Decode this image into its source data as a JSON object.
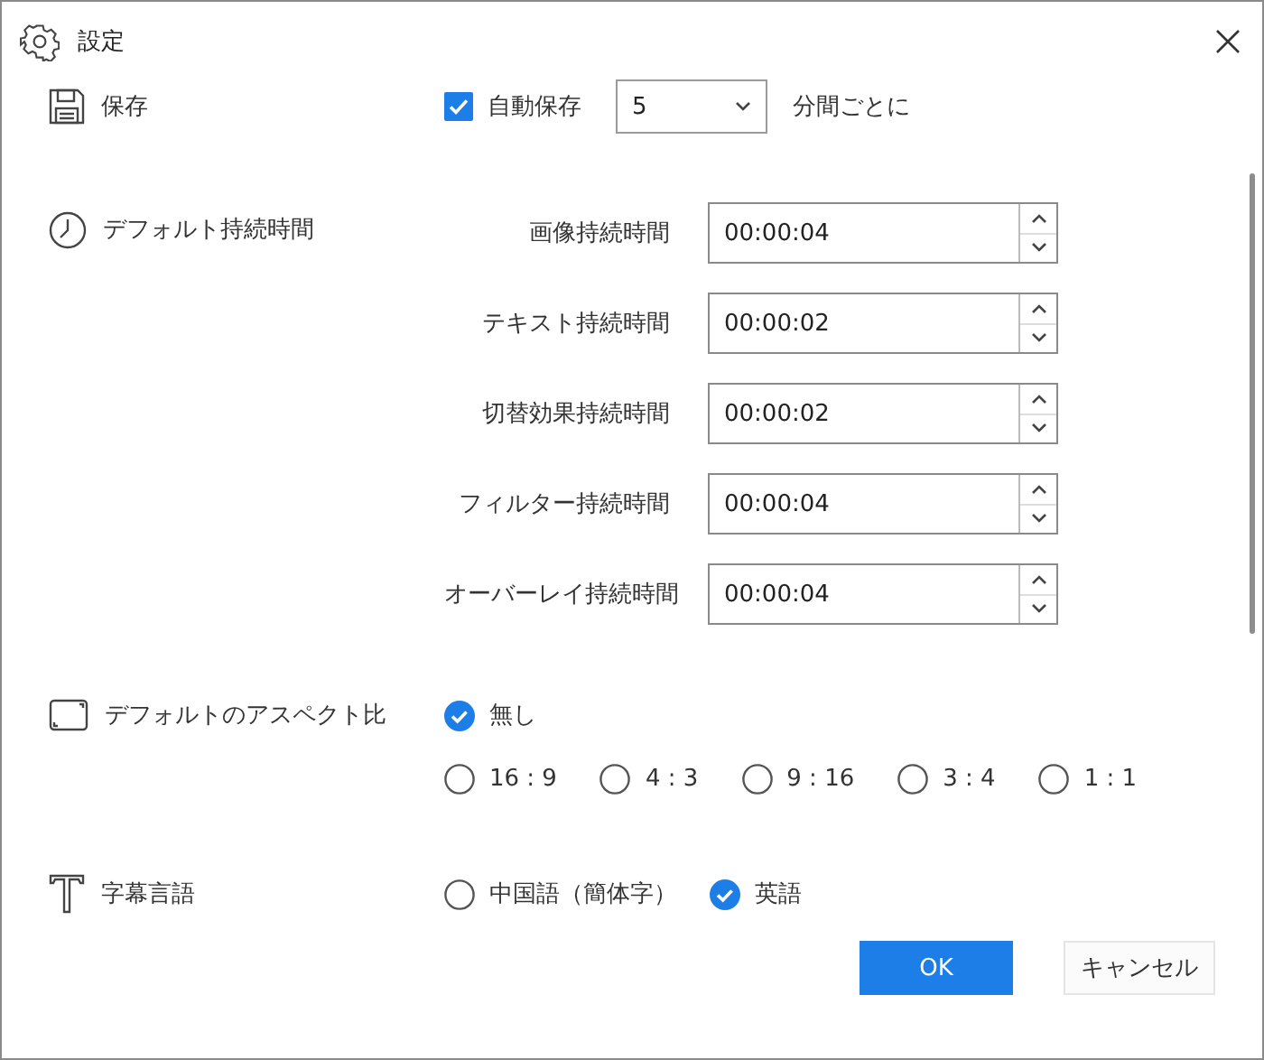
{
  "window": {
    "title": "設定"
  },
  "save": {
    "label": "保存",
    "autosave": {
      "label": "自動保存",
      "checked": true
    },
    "interval": {
      "value": "5"
    },
    "unit": "分間ごとに"
  },
  "duration": {
    "label": "デフォルト持続時間",
    "fields": [
      {
        "label": "画像持続時間",
        "value": "00:00:04"
      },
      {
        "label": "テキスト持続時間",
        "value": "00:00:02"
      },
      {
        "label": "切替効果持続時間",
        "value": "00:00:02"
      },
      {
        "label": "フィルター持続時間",
        "value": "00:00:04"
      },
      {
        "label": "オーバーレイ持続時間",
        "value": "00:00:04"
      }
    ]
  },
  "aspect": {
    "label": "デフォルトのアスペクト比",
    "options": [
      {
        "label": "無し",
        "selected": true
      },
      {
        "label": "16 : 9",
        "selected": false
      },
      {
        "label": "4 : 3",
        "selected": false
      },
      {
        "label": "9 : 16",
        "selected": false
      },
      {
        "label": "3 : 4",
        "selected": false
      },
      {
        "label": "1 : 1",
        "selected": false
      }
    ]
  },
  "subtitle": {
    "label": "字幕言語",
    "options": [
      {
        "label": "中国語（簡体字）",
        "selected": false
      },
      {
        "label": "英語",
        "selected": true
      }
    ]
  },
  "buttons": [
    {
      "label": "OK",
      "kind": "primary"
    },
    {
      "label": "キャンセル",
      "kind": "secondary"
    }
  ]
}
